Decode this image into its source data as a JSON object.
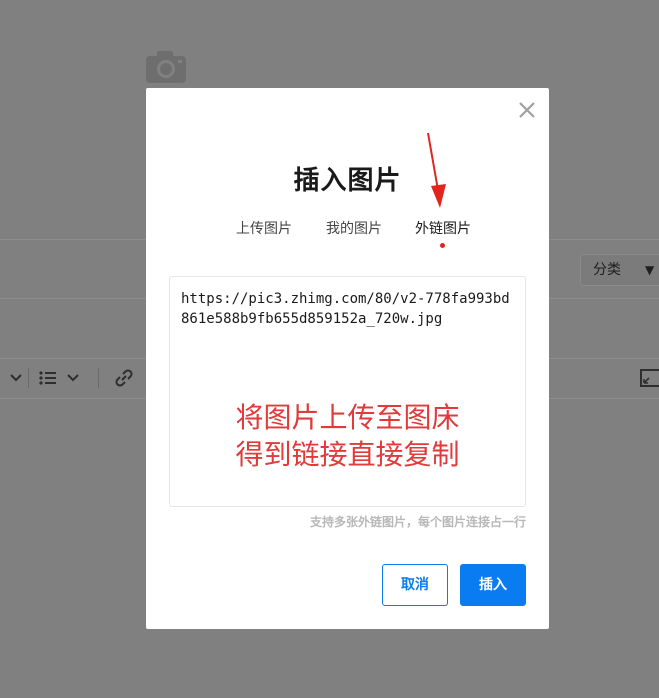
{
  "background": {
    "category_select": {
      "label": "分类",
      "caret": "▼"
    }
  },
  "modal": {
    "title": "插入图片",
    "tabs": [
      {
        "label": "上传图片",
        "active": false
      },
      {
        "label": "我的图片",
        "active": false
      },
      {
        "label": "外链图片",
        "active": true
      }
    ],
    "url_input": {
      "value": "https://pic3.zhimg.com/80/v2-778fa993bd861e588b9fb655d859152a_720w.jpg"
    },
    "annotation": {
      "line1": "将图片上传至图床",
      "line2": "得到链接直接复制"
    },
    "hint": "支持多张外链图片，每个图片连接占一行",
    "buttons": {
      "cancel": "取消",
      "insert": "插入"
    }
  },
  "colors": {
    "overlay": "#808080",
    "primary": "#0a7cf2",
    "annotation": "#e03a3a",
    "tab_indicator": "#e0261e"
  },
  "icons": {
    "camera": "camera-icon",
    "close": "close-icon",
    "chevron": "chevron-down-icon",
    "list": "list-icon",
    "link": "link-icon",
    "expand": "expand-icon"
  }
}
